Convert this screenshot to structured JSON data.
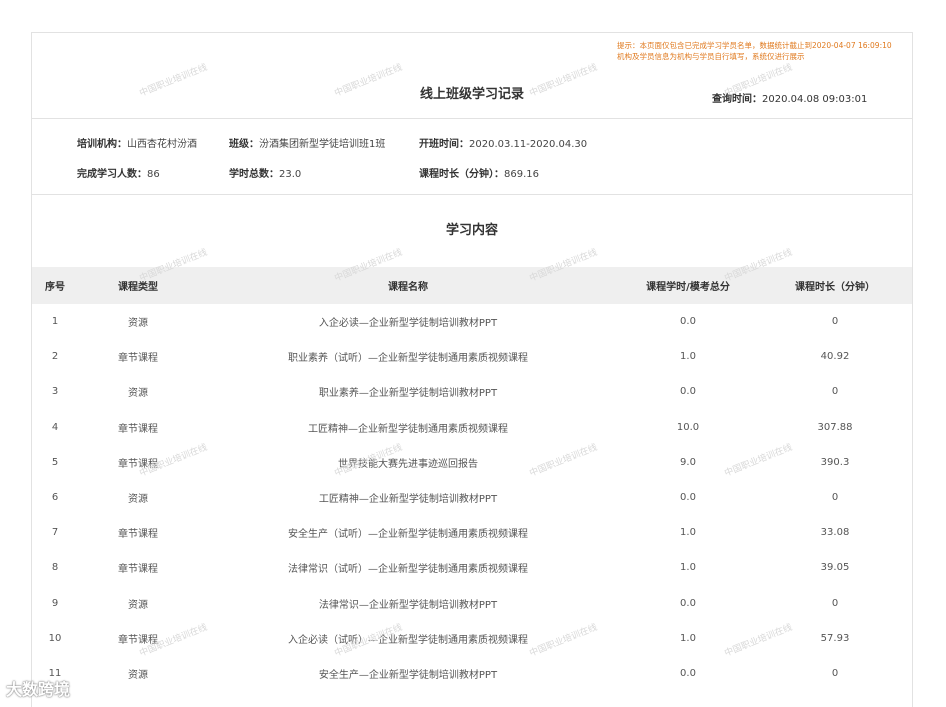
{
  "header": {
    "title": "线上班级学习记录",
    "notice_line1": "提示：本页面仅包含已完成学习学员名单，数据统计截止到2020-04-07 16:09:10",
    "notice_line2": "机构及学员信息为机构与学员自行填写，系统仅进行展示",
    "query_label": "查询时间：",
    "query_value": "2020.04.08 09:03:01"
  },
  "info": {
    "org_label": "培训机构：",
    "org_value": "山西杏花村汾酒",
    "class_label": "班级：",
    "class_value": "汾酒集团新型学徒培训班1班",
    "start_label": "开班时间：",
    "start_value": "2020.03.11-2020.04.30",
    "done_label": "完成学习人数：",
    "done_value": "86",
    "hours_label": "学时总数：",
    "hours_value": "23.0",
    "dur_label": "课程时长（分钟）：",
    "dur_value": "869.16"
  },
  "section_title": "学习内容",
  "table": {
    "columns": [
      "序号",
      "课程类型",
      "课程名称",
      "课程学时/模考总分",
      "课程时长（分钟）"
    ],
    "rows": [
      [
        "1",
        "资源",
        "入企必读—企业新型学徒制培训教材PPT",
        "0.0",
        "0"
      ],
      [
        "2",
        "章节课程",
        "职业素养（试听）—企业新型学徒制通用素质视频课程",
        "1.0",
        "40.92"
      ],
      [
        "3",
        "资源",
        "职业素养—企业新型学徒制培训教材PPT",
        "0.0",
        "0"
      ],
      [
        "4",
        "章节课程",
        "工匠精神—企业新型学徒制通用素质视频课程",
        "10.0",
        "307.88"
      ],
      [
        "5",
        "章节课程",
        "世界技能大赛先进事迹巡回报告",
        "9.0",
        "390.3"
      ],
      [
        "6",
        "资源",
        "工匠精神—企业新型学徒制培训教材PPT",
        "0.0",
        "0"
      ],
      [
        "7",
        "章节课程",
        "安全生产（试听）—企业新型学徒制通用素质视频课程",
        "1.0",
        "33.08"
      ],
      [
        "8",
        "章节课程",
        "法律常识（试听）—企业新型学徒制通用素质视频课程",
        "1.0",
        "39.05"
      ],
      [
        "9",
        "资源",
        "法律常识—企业新型学徒制培训教材PPT",
        "0.0",
        "0"
      ],
      [
        "10",
        "章节课程",
        "入企必读（试听）—企业新型学徒制通用素质视频课程",
        "1.0",
        "57.93"
      ],
      [
        "11",
        "资源",
        "安全生产—企业新型学徒制培训教材PPT",
        "0.0",
        "0"
      ]
    ]
  },
  "watermark": "中国职业培训在线",
  "corner_logo": "大数跨境",
  "colors": {
    "notice": "#e07a1f",
    "table_header_bg": "#efefef",
    "border": "#e2e2e2"
  }
}
